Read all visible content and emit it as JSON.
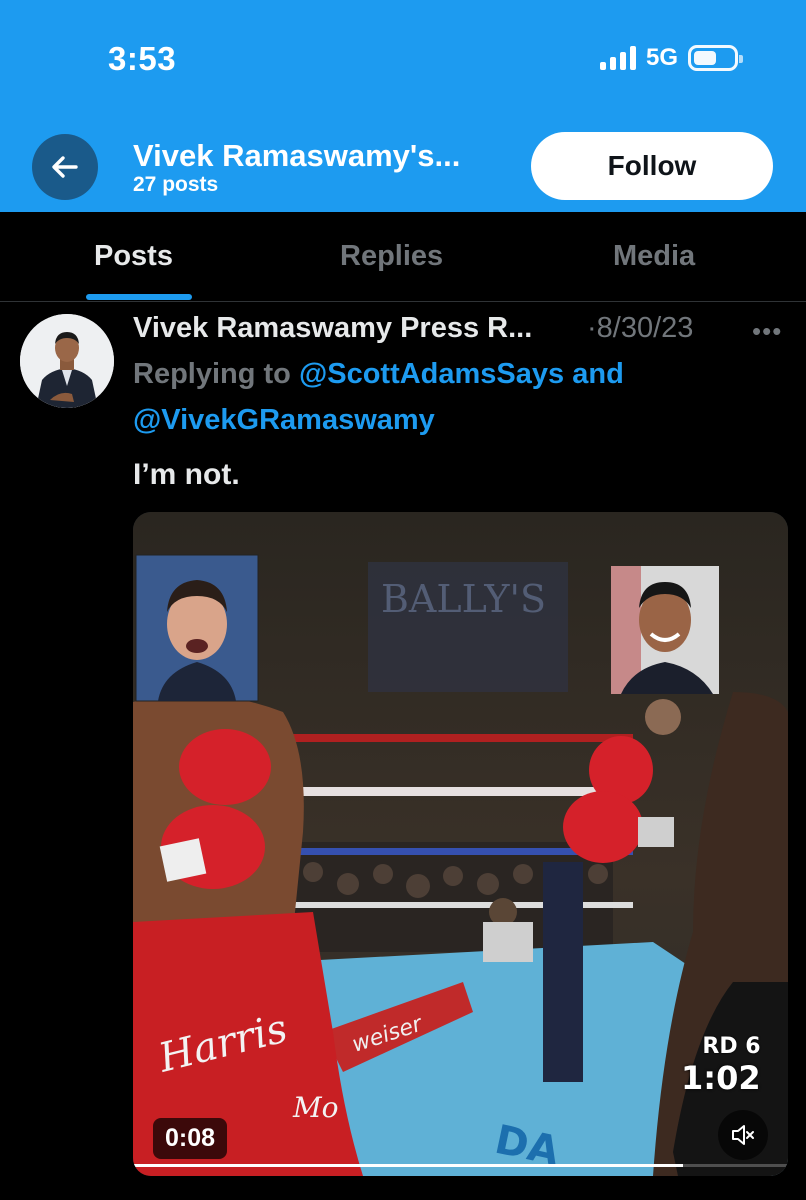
{
  "status_bar": {
    "time": "3:53",
    "network": "5G",
    "battery_level": 0.55
  },
  "header": {
    "profile_name": "Vivek Ramaswamy's...",
    "post_count": "27 posts",
    "follow_label": "Follow",
    "back_icon": "arrow-left-icon",
    "header_color": "#1d9bf0"
  },
  "tabs": [
    {
      "label": "Posts",
      "active": true
    },
    {
      "label": "Replies",
      "active": false
    },
    {
      "label": "Media",
      "active": false
    }
  ],
  "post": {
    "author": "Vivek Ramaswamy Press R...",
    "separator": "·",
    "date": "8/30/23",
    "more_icon": "more-horizontal-icon",
    "replying_prefix": "Replying to ",
    "reply_to_1": "@ScottAdamsSays",
    "reply_conj": " and",
    "reply_to_2": "@VivekGRamaswamy",
    "text": "I’m not.",
    "video": {
      "duration": "0:08",
      "mute_icon": "muted-speaker-icon",
      "round_text": "RD 6",
      "clock_text": "1:02",
      "banner_text": "BALLY'S",
      "trunks_text": "Harris",
      "progress": 0.84
    }
  },
  "colors": {
    "accent": "#1d9bf0",
    "muted_text": "#71767b",
    "background": "#000000"
  }
}
